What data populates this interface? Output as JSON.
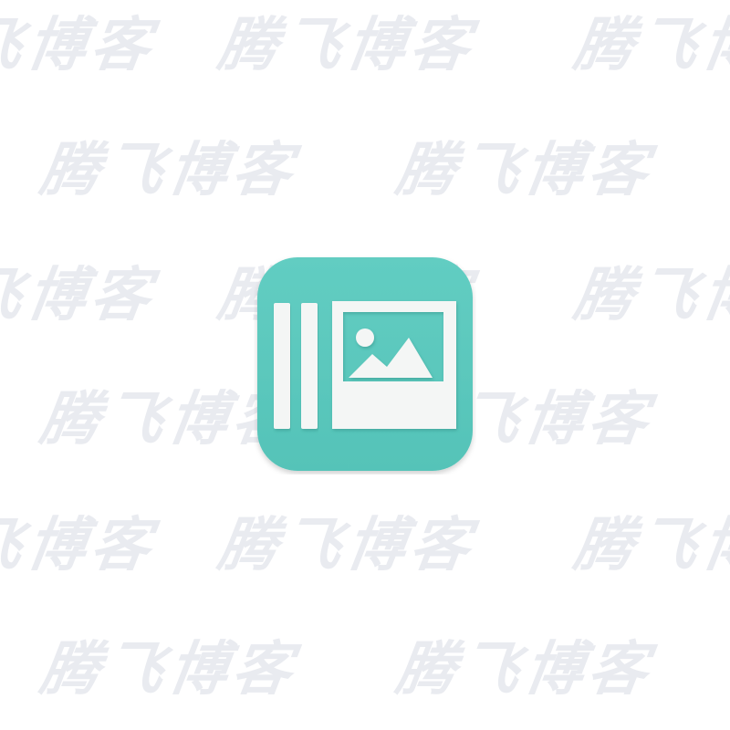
{
  "watermark": {
    "text": "腾飞博客",
    "color": "#e9ebf0"
  },
  "icon": {
    "name": "image-gallery-icon",
    "background_color": "#5cc9be",
    "foreground_color": "#f4f6f5",
    "picture_glyph": "landscape-image-icon"
  }
}
